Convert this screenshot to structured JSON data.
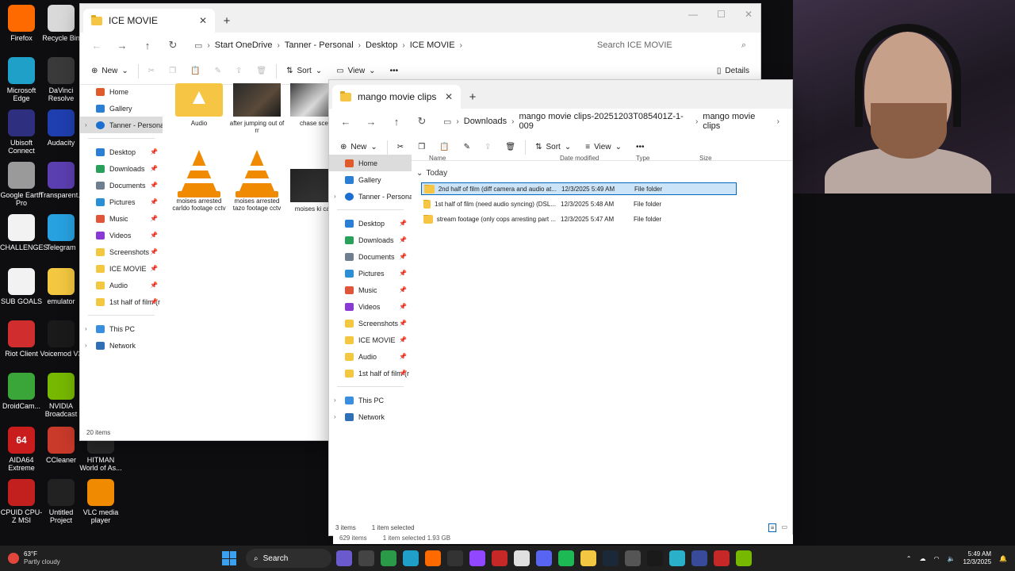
{
  "desktop": {
    "icons": [
      {
        "label": "Firefox",
        "color": "#ff6a00"
      },
      {
        "label": "Recycle Bin",
        "color": "#d9d9d9"
      },
      {
        "label": "Microsoft Edge",
        "color": "#1fa0c8"
      },
      {
        "label": "DaVinci Resolve",
        "color": "#3a3a3a"
      },
      {
        "label": "Ubisoft Connect",
        "color": "#2f2f80"
      },
      {
        "label": "Audacity",
        "color": "#1f3fb0"
      },
      {
        "label": "Google Earth Pro",
        "color": "#9a9a9a"
      },
      {
        "label": "Transparent...",
        "color": "#5b3fb0"
      },
      {
        "label": "CHALLENGES",
        "color": "#f2f2f2"
      },
      {
        "label": "Telegram",
        "color": "#27a1e0"
      },
      {
        "label": "SUB GOALS",
        "color": "#f2f2f2"
      },
      {
        "label": "emulator",
        "color": "#f3c740"
      },
      {
        "label": "Riot Client",
        "color": "#d02e2e"
      },
      {
        "label": "Voicemod V3",
        "color": "#1a1a1a"
      },
      {
        "label": "DroidCam...",
        "color": "#3aa63a"
      },
      {
        "label": "NVIDIA Broadcast",
        "color": "#76b900"
      },
      {
        "label": "AIDA64 Extreme",
        "color": "#c91c1c"
      },
      {
        "label": "CCleaner",
        "color": "#c93a2a"
      },
      {
        "label": "HITMAN World of As...",
        "color": "#2a2a2a"
      },
      {
        "label": "CPUID CPU-Z MSI",
        "color": "#c21f1f"
      },
      {
        "label": "Untitled Project",
        "color": "#222"
      },
      {
        "label": "VLC media player",
        "color": "#f08a00"
      }
    ],
    "icon_texts": [
      "",
      "",
      "",
      "",
      "",
      "",
      "",
      "",
      "",
      "",
      "",
      "",
      "",
      "",
      "",
      "",
      "64",
      "",
      "",
      "",
      "",
      ""
    ]
  },
  "back_window": {
    "tab_title": "ICE MOVIE",
    "breadcrumb": [
      "Start OneDrive",
      "Tanner - Personal",
      "Desktop",
      "ICE MOVIE"
    ],
    "search_placeholder": "Search ICE MOVIE",
    "toolbar": {
      "new": "New",
      "sort": "Sort",
      "view": "View",
      "details": "Details"
    },
    "sidebar": {
      "home": "Home",
      "gallery": "Gallery",
      "onedrive": "Tanner - Personal",
      "pinned": [
        "Desktop",
        "Downloads",
        "Documents",
        "Pictures",
        "Music",
        "Videos",
        "Screenshots",
        "ICE MOVIE",
        "Audio",
        "1st half of film (r"
      ],
      "this_pc": "This PC",
      "network": "Network"
    },
    "items": [
      "Audio",
      "after jumping out of rr",
      "chase sce",
      "moises arrested carldo footage cctv",
      "moises arrested tazo footage cctv",
      "moises ki can"
    ],
    "status": "20 items"
  },
  "front_window": {
    "tab_title": "mango movie clips",
    "breadcrumb": [
      "Downloads",
      "mango movie clips-20251203T085401Z-1-009",
      "mango movie clips"
    ],
    "toolbar": {
      "new": "New",
      "sort": "Sort",
      "view": "View"
    },
    "sidebar": {
      "home": "Home",
      "gallery": "Gallery",
      "onedrive": "Tanner - Personal",
      "pinned": [
        "Desktop",
        "Downloads",
        "Documents",
        "Pictures",
        "Music",
        "Videos",
        "Screenshots",
        "ICE MOVIE",
        "Audio",
        "1st half of film (r"
      ],
      "this_pc": "This PC",
      "network": "Network"
    },
    "columns": {
      "name": "Name",
      "date": "Date modified",
      "type": "Type",
      "size": "Size"
    },
    "group": "Today",
    "rows": [
      {
        "name": "2nd half of film (diff camera and audio at...",
        "date": "12/3/2025 5:49 AM",
        "type": "File folder",
        "selected": true
      },
      {
        "name": "1st half of film (need audio syncing) (DSL...",
        "date": "12/3/2025 5:48 AM",
        "type": "File folder",
        "selected": false
      },
      {
        "name": "stream footage (only cops arresting part ...",
        "date": "12/3/2025 5:47 AM",
        "type": "File folder",
        "selected": false
      }
    ],
    "status": {
      "count": "3 items",
      "selected": "1 item selected"
    }
  },
  "bottom_status": {
    "count": "629 items",
    "selected": "1 item selected  1.93 GB"
  },
  "taskbar": {
    "weather_temp": "63°F",
    "weather_desc": "Partly cloudy",
    "search_label": "Search",
    "time": "5:49 AM",
    "date": "12/3/2025"
  },
  "colors": {
    "accent": "#0067c0",
    "selection": "#cce4f7",
    "folder": "#f6c544"
  }
}
